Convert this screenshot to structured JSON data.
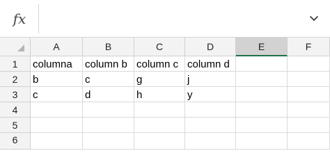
{
  "formula_bar": {
    "fx_label": "fx",
    "value": ""
  },
  "columns": [
    "A",
    "B",
    "C",
    "D",
    "E",
    "F"
  ],
  "selected_column": "E",
  "rows": [
    {
      "label": "1",
      "cells": [
        "columna",
        "column b",
        "column c",
        "column d",
        "",
        ""
      ]
    },
    {
      "label": "2",
      "cells": [
        "b",
        "c",
        "g",
        "j",
        "",
        ""
      ]
    },
    {
      "label": "3",
      "cells": [
        "c",
        "d",
        "h",
        "y",
        "",
        ""
      ]
    },
    {
      "label": "4",
      "cells": [
        "",
        "",
        "",
        "",
        "",
        ""
      ]
    },
    {
      "label": "5",
      "cells": [
        "",
        "",
        "",
        "",
        "",
        ""
      ]
    },
    {
      "label": "6",
      "cells": [
        "",
        "",
        "",
        "",
        "",
        ""
      ]
    }
  ],
  "icons": {
    "formula_expand": "chevron-down-icon",
    "select_all": "select-all-triangle-icon"
  }
}
